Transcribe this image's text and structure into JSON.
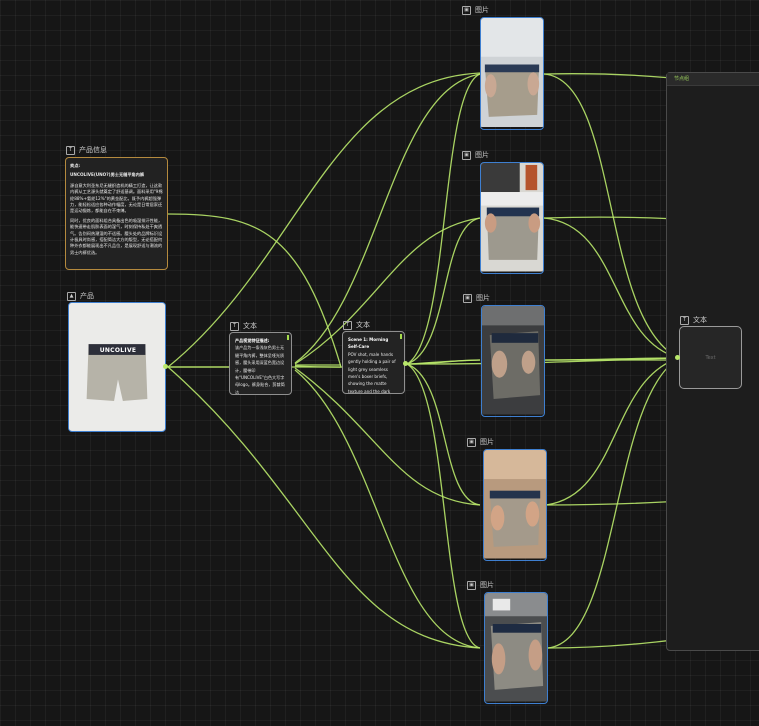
{
  "nodes": {
    "product_info": {
      "title": "产品信息",
      "lines": [
        "卖点:",
        "UNCOLIVE(UNO?)男士无缝平角内裤",
        "源自意大利圣东尼无缝织造机的精工打造，让这款内裤从工艺源头就奠定了舒适基调。面料采用\"9棉纶88%+氨纶12%\"的黄金配比，既予内裤超强弹力，能轻松适应各种动作幅度，无论是日常居家还是运动锻炼，都能自在不束缚。",
        "同时，优良的面料组合具备出色的吸湿排汗性能，能快速带走肌肤表面的湿气，时刻保持私处干爽透气。告别闷热潮湿的不适感。腰头处的品牌标识设计极具时尚感，搭配简洁大方的版型，无论搭配何种外衣都能展现出不凡品位，是展现舒适与潮流的男士内裤优选。"
      ]
    },
    "product_image": {
      "title": "产品",
      "brand_text": "UNCOLIVE"
    },
    "text1": {
      "title": "文本",
      "lines": [
        "产品视觉特征描述:",
        "该产品为一条浅灰色男士无缝平角内裤，整体呈哑光质感，腰头采用深蓝色宽边设计，腰带印有\"UNCOLIVE\"白色大写字母logo。裤身贴合，剪裁简洁"
      ]
    },
    "text2": {
      "title": "文本",
      "heading": "Scene 1: Morning Self-Care",
      "body": "POV shot, male hands gently holding a pair of light grey seamless men's boxer briefs, showing the matte texture and the dark"
    },
    "images": [
      {
        "title": "图片"
      },
      {
        "title": "图片"
      },
      {
        "title": "图片"
      },
      {
        "title": "图片"
      },
      {
        "title": "图片"
      }
    ],
    "group": {
      "title": "节点组"
    },
    "text3": {
      "title": "文本",
      "placeholder": "Text"
    }
  },
  "colors": {
    "wire": "#b9e86a",
    "image_border": "#3e7fd0",
    "info_border": "#b58a3e",
    "background": "#161616"
  },
  "icons": {
    "text": "text-icon",
    "image": "image-icon",
    "product": "product-icon"
  }
}
